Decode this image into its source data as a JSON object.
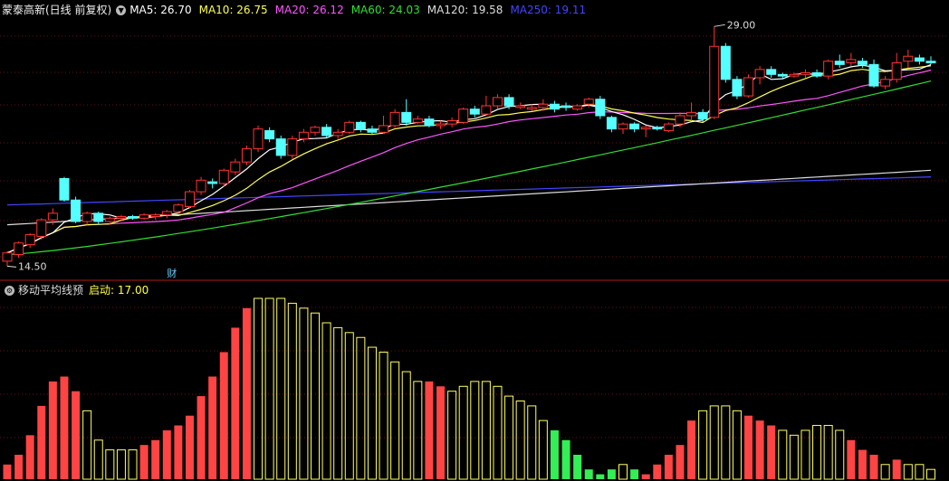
{
  "stock": {
    "title": "蒙泰高新(日线 前复权)",
    "dropdown_icon": "chevron-down-icon",
    "ma_labels": [
      {
        "name": "MA5: 26.70",
        "color": "#ffffff"
      },
      {
        "name": "MA10: 26.75",
        "color": "#ffff55"
      },
      {
        "name": "MA20: 26.12",
        "color": "#ff55ff"
      },
      {
        "name": "MA60: 24.03",
        "color": "#33dd33"
      },
      {
        "name": "MA120: 19.58",
        "color": "#dddddd"
      },
      {
        "name": "MA250: 19.11",
        "color": "#4444ff"
      }
    ],
    "high_marker": "29.00",
    "low_marker": "14.50",
    "finance_badge": "财"
  },
  "indicator": {
    "title": "移动平均线预",
    "param_label": "启动: 17.00",
    "colors": {
      "up": "#ff4444",
      "hollow": "#ffff66",
      "down": "#33ee55"
    }
  },
  "candles": [
    [
      14.8,
      15.3,
      14.5,
      15.4
    ],
    [
      15.2,
      15.9,
      15.0,
      16.0
    ],
    [
      15.8,
      16.4,
      15.6,
      16.5
    ],
    [
      16.3,
      17.3,
      16.1,
      17.4
    ],
    [
      17.3,
      17.7,
      17.0,
      18.0
    ],
    [
      19.8,
      18.5,
      18.4,
      19.9
    ],
    [
      18.5,
      17.2,
      17.1,
      18.7
    ],
    [
      17.2,
      17.7,
      17.0,
      17.8
    ],
    [
      17.7,
      17.2,
      17.0,
      17.8
    ],
    [
      17.2,
      17.4,
      17.0,
      17.5
    ],
    [
      17.4,
      17.5,
      17.2,
      17.6
    ],
    [
      17.5,
      17.4,
      17.3,
      17.6
    ],
    [
      17.4,
      17.6,
      17.3,
      17.7
    ],
    [
      17.5,
      17.6,
      17.3,
      17.7
    ],
    [
      17.6,
      17.8,
      17.4,
      17.9
    ],
    [
      17.8,
      18.2,
      17.7,
      18.3
    ],
    [
      18.1,
      19.0,
      18.0,
      19.1
    ],
    [
      19.0,
      19.7,
      18.8,
      19.9
    ],
    [
      19.6,
      19.5,
      19.2,
      19.8
    ],
    [
      19.5,
      20.3,
      19.3,
      20.4
    ],
    [
      20.2,
      20.8,
      20.0,
      21.0
    ],
    [
      20.8,
      21.6,
      20.6,
      21.8
    ],
    [
      21.6,
      22.8,
      21.4,
      23.0
    ],
    [
      22.7,
      22.2,
      22.0,
      22.9
    ],
    [
      22.2,
      21.2,
      21.0,
      22.4
    ],
    [
      21.2,
      22.2,
      21.0,
      22.4
    ],
    [
      22.2,
      22.6,
      22.0,
      22.8
    ],
    [
      22.6,
      22.9,
      22.4,
      23.0
    ],
    [
      22.9,
      22.4,
      22.3,
      23.1
    ],
    [
      22.4,
      22.6,
      22.2,
      22.8
    ],
    [
      22.6,
      23.2,
      22.5,
      23.3
    ],
    [
      23.2,
      22.8,
      22.6,
      23.3
    ],
    [
      22.8,
      22.6,
      22.5,
      23.0
    ],
    [
      22.6,
      23.0,
      22.5,
      23.6
    ],
    [
      23.0,
      23.8,
      22.9,
      24.0
    ],
    [
      23.8,
      23.2,
      23.0,
      24.6
    ],
    [
      23.2,
      23.4,
      23.1,
      23.6
    ],
    [
      23.4,
      23.0,
      22.9,
      23.6
    ],
    [
      23.0,
      23.1,
      22.8,
      23.3
    ],
    [
      23.1,
      23.3,
      22.9,
      23.5
    ],
    [
      23.2,
      24.0,
      23.1,
      24.1
    ],
    [
      24.0,
      23.7,
      23.5,
      24.2
    ],
    [
      23.7,
      24.2,
      23.6,
      24.8
    ],
    [
      24.2,
      24.7,
      24.0,
      24.9
    ],
    [
      24.7,
      24.2,
      24.0,
      24.9
    ],
    [
      24.1,
      24.2,
      24.0,
      24.4
    ],
    [
      24.0,
      24.1,
      23.9,
      24.3
    ],
    [
      24.1,
      24.3,
      23.9,
      24.6
    ],
    [
      24.3,
      24.0,
      23.8,
      24.5
    ],
    [
      24.2,
      24.1,
      23.9,
      24.4
    ],
    [
      24.0,
      24.2,
      23.9,
      24.3
    ],
    [
      24.3,
      24.6,
      24.1,
      24.7
    ],
    [
      24.6,
      23.6,
      23.4,
      24.8
    ],
    [
      23.5,
      22.8,
      22.6,
      23.6
    ],
    [
      22.8,
      23.1,
      22.5,
      23.2
    ],
    [
      23.1,
      22.8,
      22.6,
      23.2
    ],
    [
      22.8,
      22.9,
      22.3,
      23.0
    ],
    [
      22.9,
      22.8,
      22.7,
      23.0
    ],
    [
      22.7,
      23.1,
      22.6,
      23.2
    ],
    [
      23.1,
      23.6,
      22.9,
      23.8
    ],
    [
      23.6,
      23.8,
      23.3,
      24.4
    ],
    [
      23.8,
      23.4,
      23.2,
      24.0
    ],
    [
      23.5,
      27.8,
      23.4,
      29.0
    ],
    [
      27.8,
      25.8,
      25.6,
      28.0
    ],
    [
      25.8,
      24.8,
      24.6,
      26.0
    ],
    [
      24.8,
      25.9,
      24.7,
      26.1
    ],
    [
      25.9,
      26.4,
      25.5,
      26.6
    ],
    [
      26.4,
      26.1,
      25.9,
      26.6
    ],
    [
      26.1,
      26.0,
      25.8,
      26.2
    ],
    [
      26.0,
      26.1,
      25.9,
      26.2
    ],
    [
      26.1,
      26.2,
      25.9,
      26.4
    ],
    [
      26.2,
      26.0,
      25.9,
      26.4
    ],
    [
      26.0,
      26.9,
      25.8,
      27.0
    ],
    [
      26.9,
      26.7,
      26.5,
      27.3
    ],
    [
      26.8,
      27.0,
      26.6,
      27.4
    ],
    [
      26.9,
      26.7,
      26.5,
      27.1
    ],
    [
      26.7,
      25.4,
      25.3,
      27.0
    ],
    [
      25.4,
      25.8,
      25.2,
      26.0
    ],
    [
      25.8,
      26.8,
      25.6,
      27.4
    ],
    [
      26.9,
      27.2,
      26.5,
      27.6
    ],
    [
      27.1,
      26.9,
      26.7,
      27.3
    ],
    [
      26.9,
      26.8,
      26.7,
      27.2
    ]
  ],
  "indicator_values": [
    3,
    5,
    9,
    15,
    20,
    21,
    18,
    14,
    8,
    6,
    6,
    6,
    7,
    8,
    10,
    11,
    13,
    17,
    21,
    26,
    31,
    35,
    37,
    37,
    37,
    36,
    35,
    34,
    32,
    31,
    30,
    29,
    27,
    26,
    24,
    22,
    20,
    20,
    19,
    18,
    19,
    20,
    20,
    19,
    17,
    16,
    15,
    12,
    10,
    8,
    5,
    2,
    1,
    2,
    3,
    2,
    1,
    3,
    5,
    7,
    12,
    14,
    15,
    15,
    14,
    13,
    12,
    11,
    10,
    9,
    10,
    11,
    11,
    10,
    8,
    6,
    5,
    3,
    4,
    3,
    3,
    2
  ],
  "indicator_kinds": "rrrrrrrhhhhhrrrrrrrrrrhhhhhhhhhhhhhhhrrhhhhhhhhhgggggghgrrrrrhhhhrrrhhhhhhrrrhr"
}
